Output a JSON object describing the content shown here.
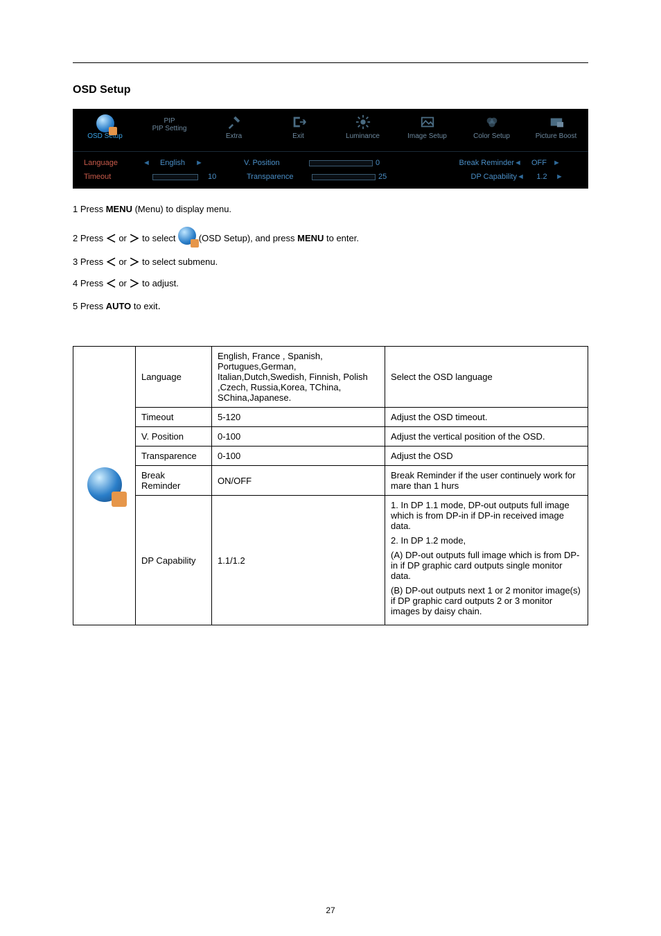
{
  "page_number": "27",
  "section_title": "OSD Setup",
  "osd": {
    "tabs": [
      {
        "label": "OSD Setup",
        "active": true
      },
      {
        "label_top": "PIP",
        "label": "PIP Setting"
      },
      {
        "label": "Extra"
      },
      {
        "label": "Exit"
      },
      {
        "label": "Luminance"
      },
      {
        "label": "Image Setup"
      },
      {
        "label": "Color Setup"
      },
      {
        "label": "Picture Boost"
      }
    ],
    "rows": [
      {
        "label1": "Language",
        "val1": "English",
        "label2": "V. Position",
        "bar_pct": 0,
        "num": "0",
        "label3": "Break Reminder",
        "val3": "OFF"
      },
      {
        "label1": "Timeout",
        "val1_slider_pct": 10,
        "val1_num": "10",
        "label2": "Transparence",
        "bar_pct": 25,
        "num": "25",
        "label3": "DP Capability",
        "val3": "1.2"
      }
    ]
  },
  "steps": {
    "s1_a": "1 Press ",
    "s1_menu": "MENU",
    "s1_b": " (Menu) to display menu.",
    "s2_a": "2 Press ",
    "s2_b": "  or  ",
    "s2_c": "  to select  ",
    "s2_d": "  (OSD Setup), and press ",
    "s2_menu": "MENU",
    "s2_e": " to enter.",
    "s3_a": "3 Press ",
    "s3_b": "  or  ",
    "s3_c": "  to select submenu.",
    "s4_a": "4 Press ",
    "s4_b": " or ",
    "s4_c": " to adjust.",
    "s5_a": "5 Press  ",
    "s5_auto": "AUTO",
    "s5_b": "  to exit",
    "s5_dot": "."
  },
  "table": {
    "rows": [
      {
        "name": "Language",
        "range": "English, France , Spanish, Portugues,German, Italian,Dutch,Swedish, Finnish, Polish ,Czech, Russia,Korea, TChina, SChina,Japanese.",
        "desc": "Select the OSD language"
      },
      {
        "name": "Timeout",
        "range": "5-120",
        "desc": "Adjust the OSD timeout."
      },
      {
        "name": "V. Position",
        "range": "0-100",
        "desc": "Adjust the vertical position of the OSD."
      },
      {
        "name": "Transparence",
        "range": "0-100",
        "desc": "Adjust the OSD"
      },
      {
        "name": "Break Reminder",
        "range": "ON/OFF",
        "desc": "Break Reminder if the user continuely work for mare than 1 hurs"
      },
      {
        "name": "DP Capability",
        "range": "1.1/1.2",
        "desc_parts": {
          "p1": "1. In DP 1.1 mode, DP-out outputs full image which is from DP-in if DP-in received image data.",
          "p2": "2. In DP 1.2 mode,",
          "p3": "(A)   DP-out outputs full image which is from DP-in if DP graphic card outputs single monitor data.",
          "p4": "(B)   DP-out outputs next 1 or 2 monitor image(s) if DP graphic card outputs 2 or 3 monitor images by daisy chain."
        }
      }
    ]
  }
}
